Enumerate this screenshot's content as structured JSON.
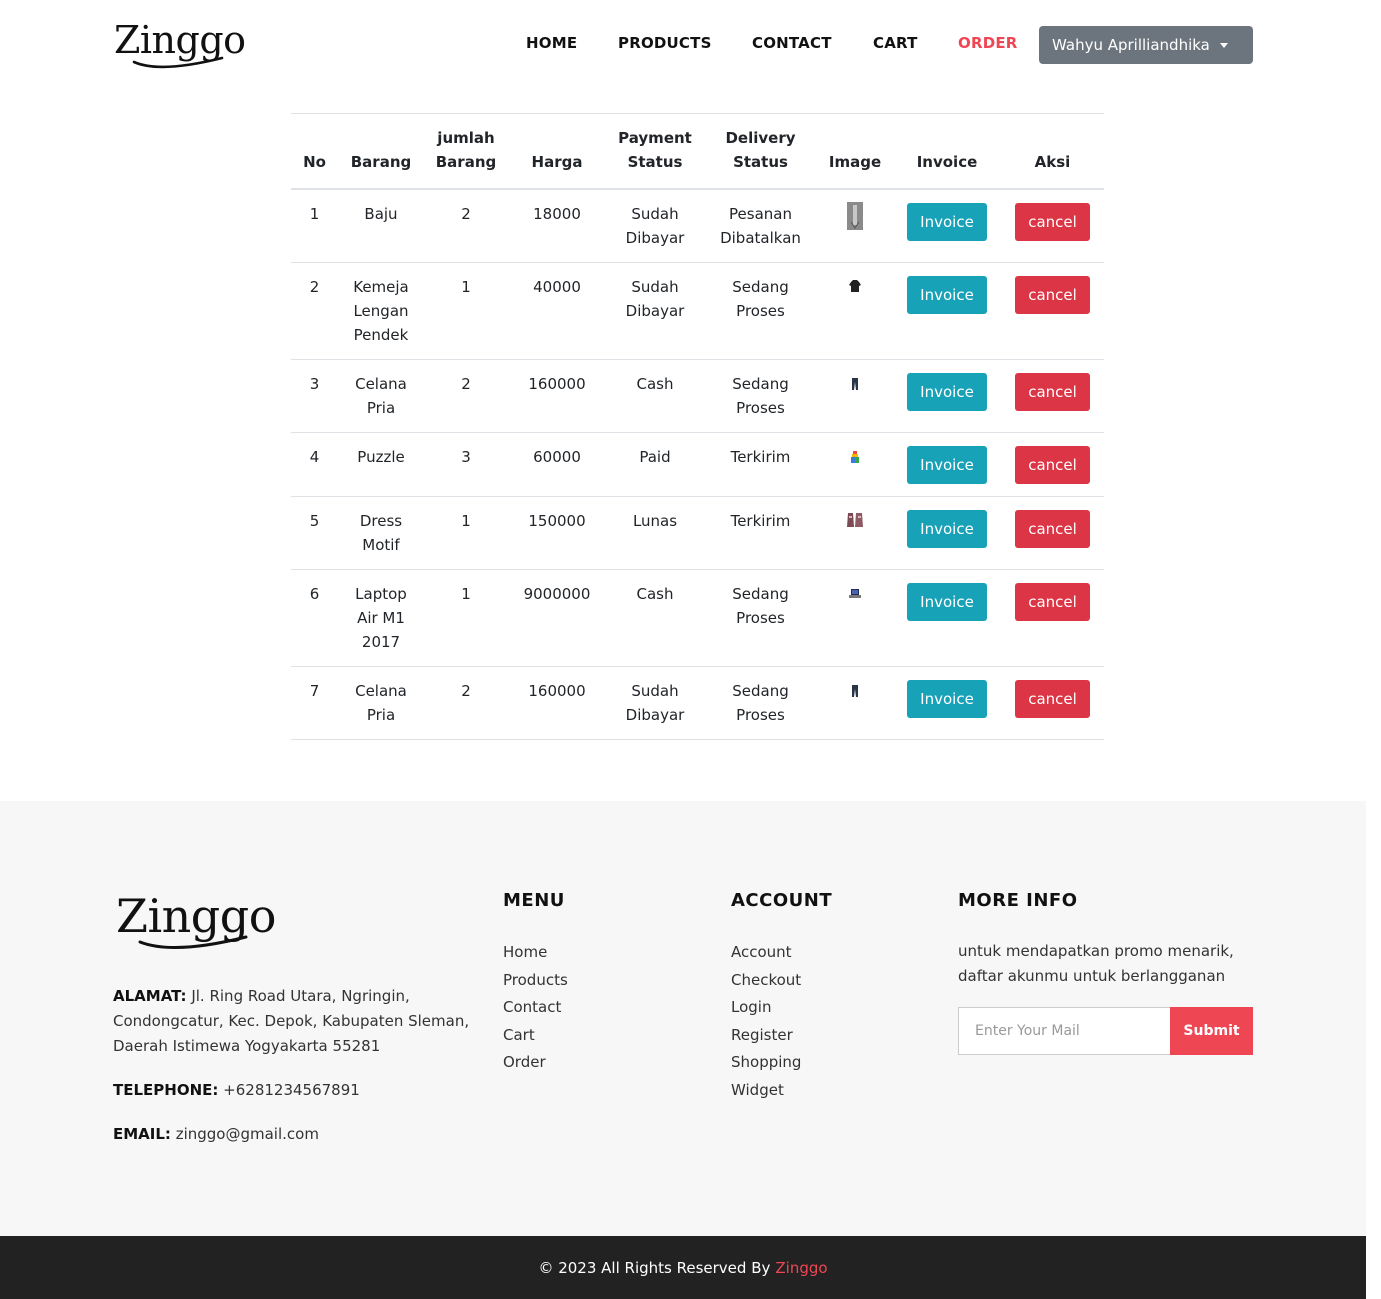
{
  "brand": {
    "name": "Zinggo",
    "accent": "#ef4654"
  },
  "nav": {
    "home": "HOME",
    "products": "PRODUCTS",
    "contact": "CONTACT",
    "cart": "CART",
    "order": "ORDER",
    "user": "Wahyu Aprilliandhika"
  },
  "table": {
    "headers": {
      "no": "No",
      "barang": "Barang",
      "jumlah": "jumlah Barang",
      "harga": "Harga",
      "payment": "Payment Status",
      "delivery": "Delivery Status",
      "image": "Image",
      "invoice": "Invoice",
      "aksi": "Aksi"
    },
    "invoice_label": "Invoice",
    "cancel_label": "cancel",
    "rows": [
      {
        "no": "1",
        "barang": "Baju",
        "jumlah": "2",
        "harga": "18000",
        "payment": "Sudah Dibayar",
        "delivery": "Pesanan Dibatalkan",
        "image": "shirt-thumbnail"
      },
      {
        "no": "2",
        "barang": "Kemeja Lengan Pendek",
        "jumlah": "1",
        "harga": "40000",
        "payment": "Sudah Dibayar",
        "delivery": "Sedang Proses",
        "image": "tshirt-thumbnail"
      },
      {
        "no": "3",
        "barang": "Celana Pria",
        "jumlah": "2",
        "harga": "160000",
        "payment": "Cash",
        "delivery": "Sedang Proses",
        "image": "pants-thumbnail"
      },
      {
        "no": "4",
        "barang": "Puzzle",
        "jumlah": "3",
        "harga": "60000",
        "payment": "Paid",
        "delivery": "Terkirim",
        "image": "puzzle-thumbnail"
      },
      {
        "no": "5",
        "barang": "Dress Motif",
        "jumlah": "1",
        "harga": "150000",
        "payment": "Lunas",
        "delivery": "Terkirim",
        "image": "dress-thumbnail"
      },
      {
        "no": "6",
        "barang": "Laptop Air M1 2017",
        "jumlah": "1",
        "harga": "9000000",
        "payment": "Cash",
        "delivery": "Sedang Proses",
        "image": "laptop-thumbnail"
      },
      {
        "no": "7",
        "barang": "Celana Pria",
        "jumlah": "2",
        "harga": "160000",
        "payment": "Sudah Dibayar",
        "delivery": "Sedang Proses",
        "image": "pants-thumbnail"
      }
    ]
  },
  "footer": {
    "alamat_label": "ALAMAT:",
    "alamat": "Jl. Ring Road Utara, Ngringin, Condongcatur, Kec. Depok, Kabupaten Sleman, Daerah Istimewa Yogyakarta 55281",
    "telephone_label": "TELEPHONE:",
    "telephone": "+6281234567891",
    "email_label": "EMAIL:",
    "email": "zinggo@gmail.com",
    "menu_title": "MENU",
    "menu": [
      "Home",
      "Products",
      "Contact",
      "Cart",
      "Order"
    ],
    "account_title": "ACCOUNT",
    "account": [
      "Account",
      "Checkout",
      "Login",
      "Register",
      "Shopping",
      "Widget"
    ],
    "more_title": "MORE INFO",
    "promo": "untuk mendapatkan promo menarik, daftar akunmu untuk berlangganan",
    "mail_placeholder": "Enter Your Mail",
    "submit": "Submit",
    "copyright": "© 2023 All Rights Reserved By",
    "copyright_brand": "Zinggo"
  }
}
